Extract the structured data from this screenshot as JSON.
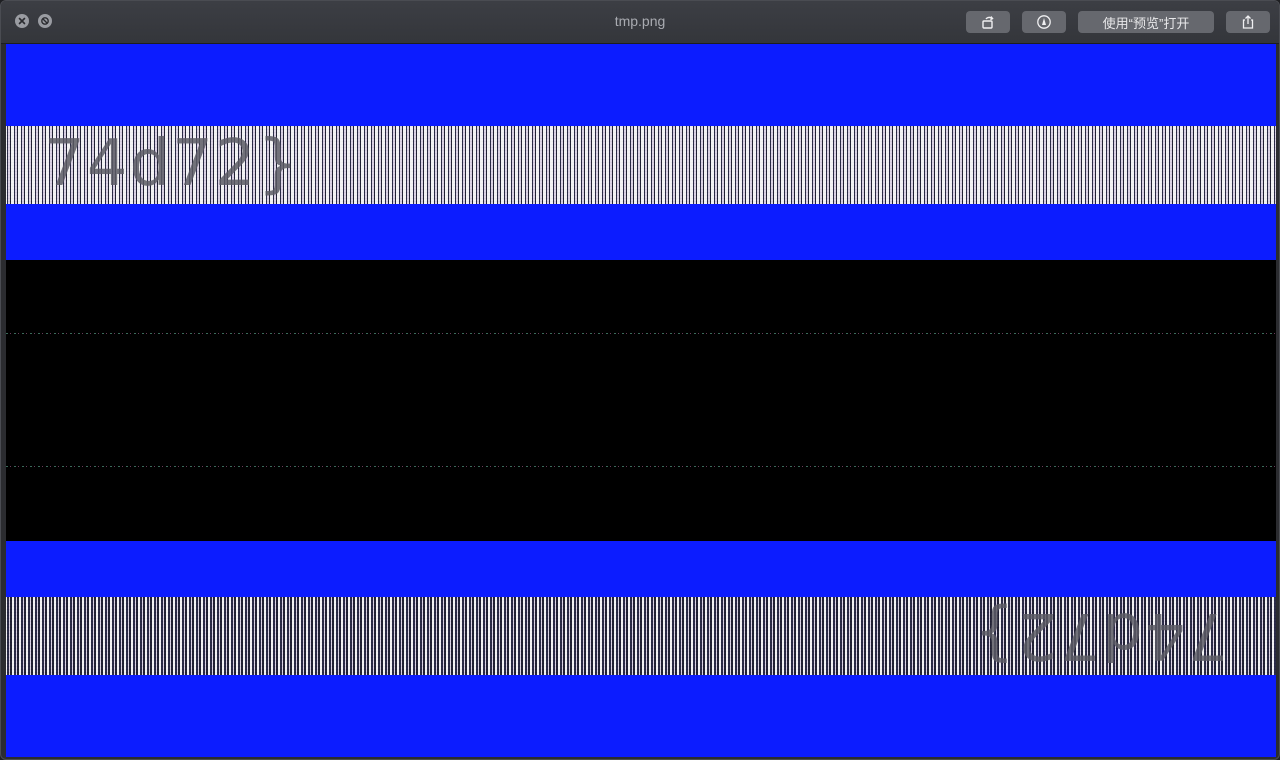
{
  "window": {
    "title": "tmp.png"
  },
  "toolbar": {
    "rotate_icon": "rotate-icon",
    "markup_icon": "markup-pen-icon",
    "open_with_preview_label": "使用“预览”打开",
    "share_icon": "share-icon"
  },
  "controls": {
    "close_icon": "close-icon",
    "noentry_icon": "no-entry-icon"
  },
  "image": {
    "top_band_text": "74d72}",
    "bottom_band_text": "74d72}",
    "colors": {
      "blue": "#0c1cff",
      "black": "#000000"
    }
  }
}
